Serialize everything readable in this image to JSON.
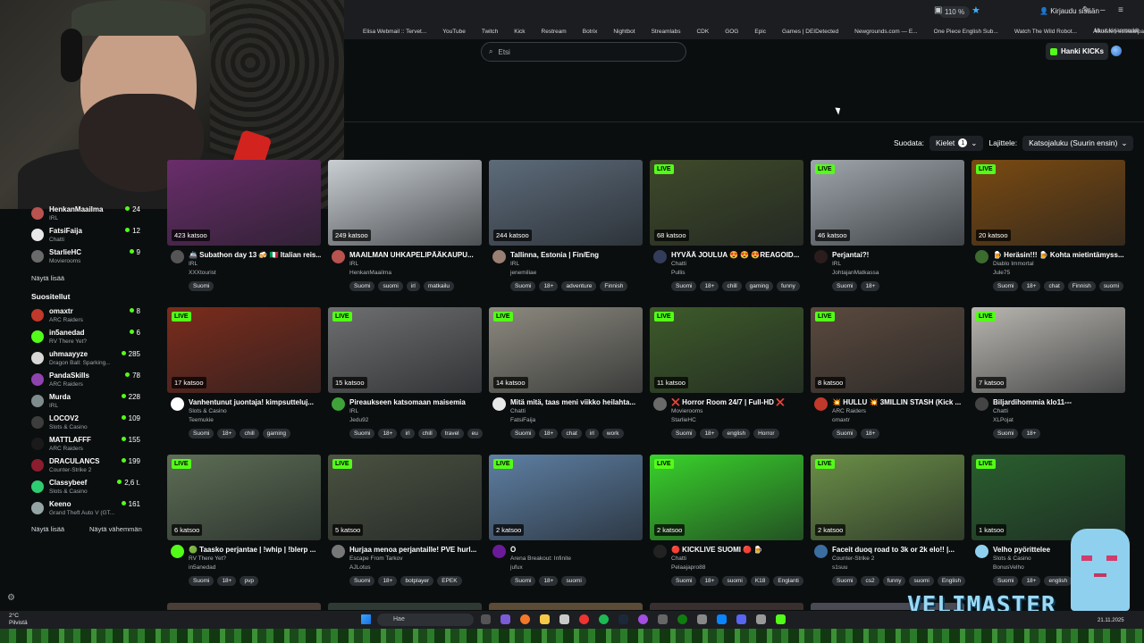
{
  "browser": {
    "zoom": "110 %",
    "signin": "Kirjaudu sisään",
    "bookmarks": [
      "Elisa Webmail :: Tervet...",
      "YouTube",
      "Twitch",
      "Kick",
      "Restream",
      "Botrix",
      "Nightbot",
      "Streamlabs",
      "CDK",
      "GOG",
      "Epic",
      "Games | DEIDetected",
      "Newgrounds.com — E...",
      "One Piece English Sub...",
      "Watch The Wild Robot...",
      "Aikuisten sosiaalipalve..."
    ],
    "bookmarks_more": "Muut kirjanmerkit"
  },
  "header": {
    "search_placeholder": "Etsi",
    "kicks_button": "Hanki KICKs"
  },
  "filters": {
    "label": "Suodata:",
    "languages": "Kielet",
    "languages_count": "1",
    "sort_label": "Lajittele:",
    "sort_value": "Katsojaluku (Suurin ensin)"
  },
  "sidebar": {
    "top_items": [
      {
        "name": "HenkanMaailma",
        "game": "IRL",
        "viewers": "24",
        "color": "#b8534f"
      },
      {
        "name": "FatsiFaija",
        "game": "Chatti",
        "viewers": "12",
        "color": "#e8e8e8"
      },
      {
        "name": "StarlieHC",
        "game": "Movierooms",
        "viewers": "9",
        "color": "#6a6a6a"
      }
    ],
    "show_more": "Näytä lisää",
    "recommended_title": "Suositellut",
    "recommended": [
      {
        "name": "omaxtr",
        "game": "ARC Raiders",
        "viewers": "8",
        "color": "#c0392b"
      },
      {
        "name": "in5anedad",
        "game": "RV There Yet?",
        "viewers": "6",
        "color": "#53fc18"
      },
      {
        "name": "uhmaayyze",
        "game": "Dragon Ball: Sparking...",
        "viewers": "285",
        "color": "#d8d8d8"
      },
      {
        "name": "PandaSkills",
        "game": "ARC Raiders",
        "viewers": "78",
        "color": "#8e44ad"
      },
      {
        "name": "Murda",
        "game": "IRL",
        "viewers": "228",
        "color": "#7f8c8d"
      },
      {
        "name": "LOCOV2",
        "game": "Slots & Casino",
        "viewers": "109",
        "color": "#3d3d3d"
      },
      {
        "name": "MATTLAFFF",
        "game": "ARC Raiders",
        "viewers": "155",
        "color": "#1a1a1a"
      },
      {
        "name": "DRACULANCS",
        "game": "Counter-Strike 2",
        "viewers": "199",
        "color": "#8b1e2e"
      },
      {
        "name": "Classybeef",
        "game": "Slots & Casino",
        "viewers": "2,6 t.",
        "color": "#2ecc71"
      },
      {
        "name": "Keeno",
        "game": "Grand Theft Auto V (GT...",
        "viewers": "161",
        "color": "#95a5a6"
      }
    ],
    "show_more2": "Näytä lisää",
    "show_less": "Näytä vähemmän"
  },
  "streams": [
    {
      "title": "🚢 Subathon day 13 🍻 🇮🇹 Italian reis...",
      "category": "IRL",
      "user": "XXXtourist",
      "viewers": "423 katsoo",
      "tags": [
        "Suomi"
      ],
      "thumb": "#6a2d6b",
      "avatar": "#555"
    },
    {
      "title": "MAAILMAN UHKAPELIPÄÄKAUPU...",
      "category": "IRL",
      "user": "HenkanMaailma",
      "viewers": "249 katsoo",
      "tags": [
        "Suomi",
        "suomi",
        "irl",
        "matkailu"
      ],
      "thumb": "#c9ced2",
      "avatar": "#b8534f"
    },
    {
      "title": "Tallinna, Estonia | Fin/Eng",
      "category": "IRL",
      "user": "jenemiliae",
      "viewers": "244 katsoo",
      "tags": [
        "Suomi",
        "18+",
        "adventure",
        "Finnish"
      ],
      "thumb": "#5d6b7a",
      "avatar": "#9a7f73"
    },
    {
      "title": "HYVÄÄ JOULUA 😍 😍 😍REAGOID...",
      "category": "Chatti",
      "user": "Pullis",
      "viewers": "68 katsoo",
      "tags": [
        "Suomi",
        "18+",
        "chill",
        "gaming",
        "funny"
      ],
      "thumb": "#3f4a2a",
      "avatar": "#333c5a"
    },
    {
      "title": "Perjantai?!",
      "category": "IRL",
      "user": "JohtajanMatkassa",
      "viewers": "46 katsoo",
      "tags": [
        "Suomi",
        "18+"
      ],
      "thumb": "#9ea5ab",
      "avatar": "#2b1d1d"
    },
    {
      "title": "🍺 Heräsin!!! 🍺 Kohta mietintämyss...",
      "category": "Diablo Immortal",
      "user": "Jule75",
      "viewers": "20 katsoo",
      "tags": [
        "Suomi",
        "18+",
        "chat",
        "Finnish",
        "suomi"
      ],
      "thumb": "#7a4a12",
      "avatar": "#3b6b2f"
    },
    {
      "title": "Vanhentunut juontaja! kimpsutteluj...",
      "category": "Slots & Casino",
      "user": "Teemukie",
      "viewers": "17 katsoo",
      "tags": [
        "Suomi",
        "18+",
        "chill",
        "gaming"
      ],
      "thumb": "#7c2c1c",
      "avatar": "#ffffff"
    },
    {
      "title": "Pireaukseen katsomaan maisemia",
      "category": "IRL",
      "user": "Jedu92",
      "viewers": "15 katsoo",
      "tags": [
        "Suomi",
        "18+",
        "irl",
        "chill",
        "travel",
        "eu"
      ],
      "thumb": "#6e6f70",
      "avatar": "#3fa33a"
    },
    {
      "title": "Mitä mitä, taas meni viikko heilahta...",
      "category": "Chatti",
      "user": "FatsiFaija",
      "viewers": "14 katsoo",
      "tags": [
        "Suomi",
        "18+",
        "chat",
        "irl",
        "work"
      ],
      "thumb": "#8d8a7f",
      "avatar": "#e8e8e8"
    },
    {
      "title": "❌ Horror Room 24/7 | Full-HD ❌",
      "category": "Movierooms",
      "user": "StarlieHC",
      "viewers": "11 katsoo",
      "tags": [
        "Suomi",
        "18+",
        "english",
        "Horror"
      ],
      "thumb": "#3e5b2a",
      "avatar": "#6a6a6a"
    },
    {
      "title": "💥 HULLU 💥 3MILLIN STASH (Kick ...",
      "category": "ARC Raiders",
      "user": "omaxtr",
      "viewers": "8 katsoo",
      "tags": [
        "Suomi",
        "18+"
      ],
      "thumb": "#5b4a3e",
      "avatar": "#c0392b"
    },
    {
      "title": "Biljardihommia klo11---",
      "category": "Chatti",
      "user": "XLPojat",
      "viewers": "7 katsoo",
      "tags": [
        "Suomi",
        "18+"
      ],
      "thumb": "#b9b6b0",
      "avatar": "#444"
    },
    {
      "title": "🟢 Taasko perjantae | !whip | !blerp ...",
      "category": "RV There Yet?",
      "user": "in5anedad",
      "viewers": "6 katsoo",
      "tags": [
        "Suomi",
        "18+",
        "pvp"
      ],
      "thumb": "#5d6e55",
      "avatar": "#53fc18"
    },
    {
      "title": "Hurjaa menoa perjantaille! PVE hurl...",
      "category": "Escape From Tarkov",
      "user": "AJLotus",
      "viewers": "5 katsoo",
      "tags": [
        "Suomi",
        "18+",
        "botplayer",
        "EPEK"
      ],
      "thumb": "#4a5240",
      "avatar": "#777"
    },
    {
      "title": "Ö",
      "category": "Arena Breakout: Infinite",
      "user": "jufux",
      "viewers": "2 katsoo",
      "tags": [
        "Suomi",
        "18+",
        "suomi"
      ],
      "thumb": "#5e7fa3",
      "avatar": "#6a1b9a"
    },
    {
      "title": "🔴 KICKLIVE SUOMI 🔴 🍺",
      "category": "Chatti",
      "user": "Pelaajapro88",
      "viewers": "2 katsoo",
      "tags": [
        "Suomi",
        "18+",
        "suomi",
        "K18",
        "Englanti"
      ],
      "thumb": "#39d32b",
      "avatar": "#222"
    },
    {
      "title": "Faceit duoq road to 3k or 2k elo!! |...",
      "category": "Counter-Strike 2",
      "user": "s1suu",
      "viewers": "2 katsoo",
      "tags": [
        "Suomi",
        "cs2",
        "funny",
        "suomi",
        "English"
      ],
      "thumb": "#6b8f47",
      "avatar": "#3b6ea0"
    },
    {
      "title": "Velho pyörittelee",
      "category": "Slots & Casino",
      "user": "BonusVelho",
      "viewers": "1 katsoo",
      "tags": [
        "Suomi",
        "18+",
        "english"
      ],
      "thumb": "#2a5f2e",
      "avatar": "#8fd0ef"
    }
  ],
  "live_label": "LIVE",
  "taskbar": {
    "temp": "2°C",
    "weather": "Pilvistä",
    "search": "Hae",
    "date": "21.11.2025"
  },
  "overlay": {
    "brand": "VELIMASTER"
  }
}
